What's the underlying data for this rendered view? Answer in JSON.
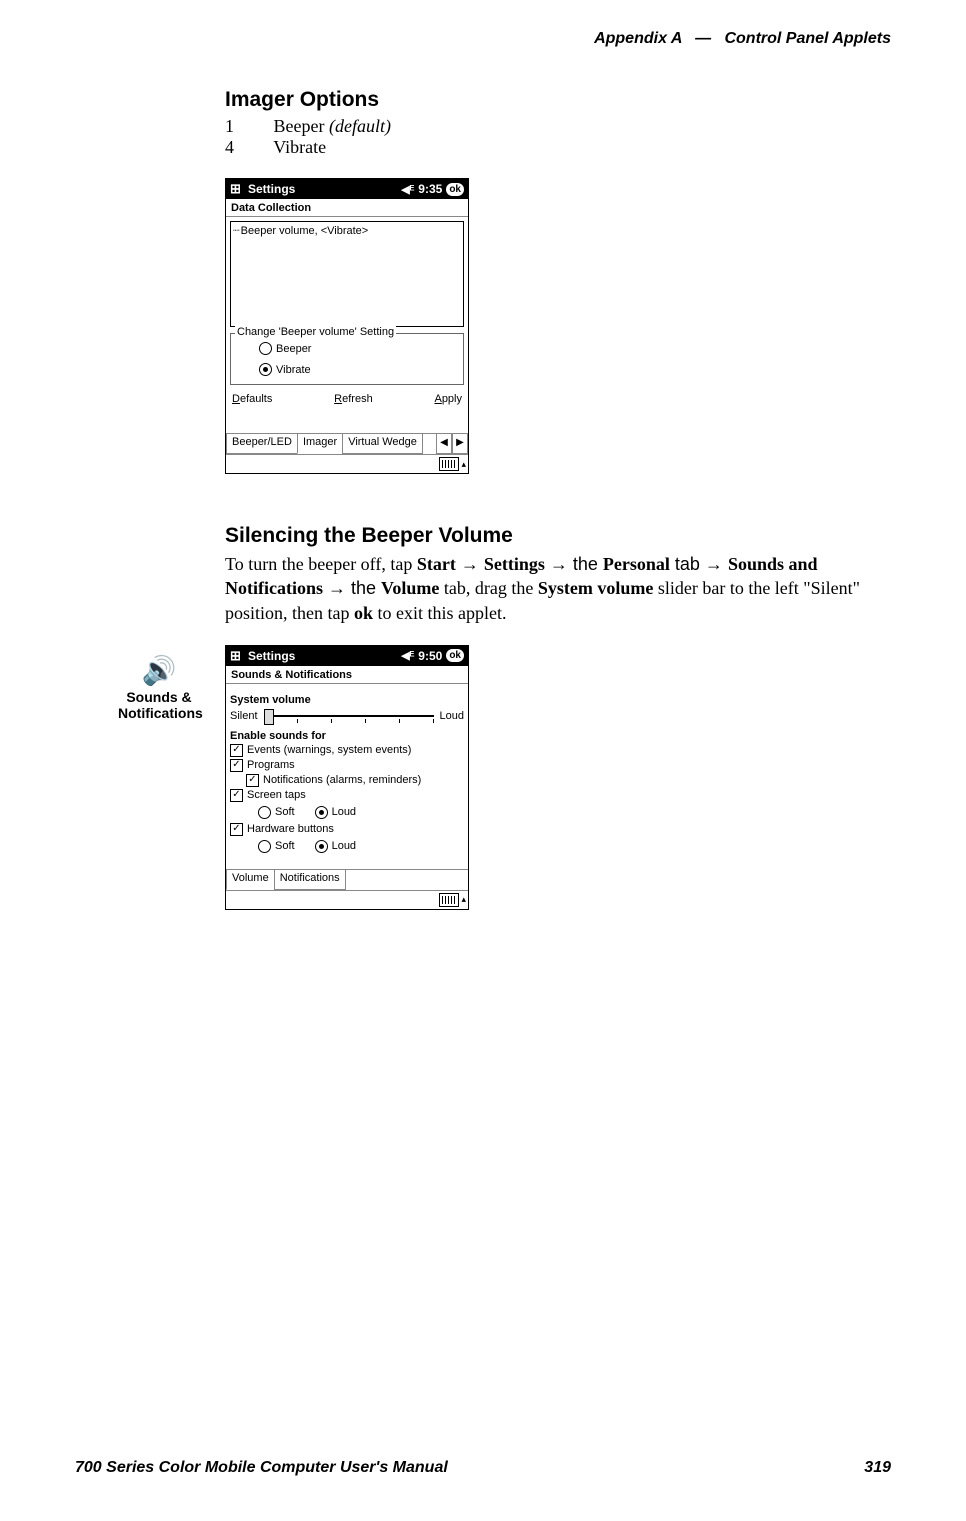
{
  "header": {
    "appendix": "Appendix A",
    "separator": "—",
    "title": "Control Panel Applets"
  },
  "imager": {
    "heading": "Imager Options",
    "options": [
      {
        "num": "1",
        "label": "Beeper",
        "suffix": "(default)"
      },
      {
        "num": "4",
        "label": "Vibrate",
        "suffix": ""
      }
    ]
  },
  "pda1": {
    "title": "Settings",
    "time": "9:35",
    "ok": "ok",
    "subhead": "Data Collection",
    "list_item": "Beeper volume, <Vibrate>",
    "group_legend": "Change 'Beeper volume' Setting",
    "radio_beeper": "Beeper",
    "radio_vibrate": "Vibrate",
    "btn_defaults": {
      "u": "D",
      "rest": "efaults"
    },
    "btn_refresh": {
      "u": "R",
      "rest": "efresh"
    },
    "btn_apply": {
      "u": "A",
      "rest": "pply"
    },
    "tabs": [
      "Beeper/LED",
      "Imager",
      "Virtual Wedge"
    ]
  },
  "silence": {
    "heading": "Silencing the Beeper Volume",
    "sidebar_label": "Sounds & Notifications",
    "text": {
      "p1a": "To turn the beeper off, tap ",
      "start": "Start",
      "arrow": " → ",
      "settings": "Settings",
      "p1b": " → the ",
      "personal": "Personal",
      "p1c": " tab → ",
      "sounds": "Sounds and Notifications",
      "p1d": "  → the ",
      "volume": "Volume",
      "p1e": " tab, drag the ",
      "system_volume": "System volume",
      "p1f": " slider bar to the left \"Silent\" position, then tap ",
      "ok": "ok",
      "p1g": " to exit this applet."
    }
  },
  "pda2": {
    "title": "Settings",
    "time": "9:50",
    "ok": "ok",
    "subhead": "Sounds & Notifications",
    "sysvol_label": "System volume",
    "silent": "Silent",
    "loud": "Loud",
    "enable_label": "Enable sounds for",
    "events": "Events (warnings, system events)",
    "programs": "Programs",
    "notifications": "Notifications (alarms, reminders)",
    "screentaps": "Screen taps",
    "soft": "Soft",
    "loud2": "Loud",
    "hwbuttons": "Hardware buttons",
    "tabs": [
      "Volume",
      "Notifications"
    ]
  },
  "footer": {
    "manual": "700 Series Color Mobile Computer User's Manual",
    "page": "319"
  }
}
